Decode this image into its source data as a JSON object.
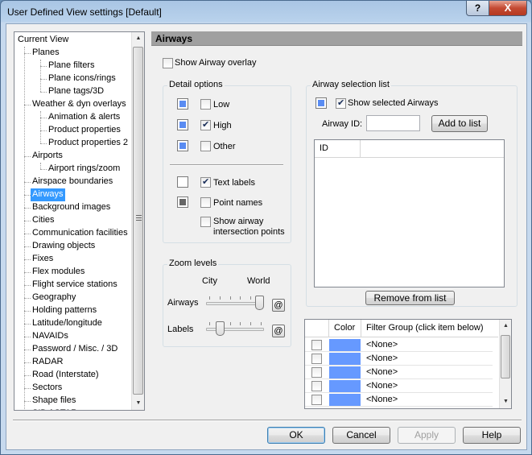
{
  "window": {
    "title": "User Defined View settings  [Default]",
    "help_label": "?",
    "close_label": "X"
  },
  "tree": {
    "items": [
      {
        "label": "Current View",
        "level": 0
      },
      {
        "label": "Planes",
        "level": 1
      },
      {
        "label": "Plane filters",
        "level": 2
      },
      {
        "label": "Plane icons/rings",
        "level": 2
      },
      {
        "label": "Plane tags/3D",
        "level": 2
      },
      {
        "label": "Weather & dyn overlays",
        "level": 1
      },
      {
        "label": "Animation & alerts",
        "level": 2
      },
      {
        "label": "Product properties",
        "level": 2
      },
      {
        "label": "Product properties 2",
        "level": 2
      },
      {
        "label": "Airports",
        "level": 1
      },
      {
        "label": "Airport rings/zoom",
        "level": 2
      },
      {
        "label": "Airspace boundaries",
        "level": 1
      },
      {
        "label": "Airways",
        "level": 1,
        "selected": true
      },
      {
        "label": "Background images",
        "level": 1
      },
      {
        "label": "Cities",
        "level": 1
      },
      {
        "label": "Communication facilities",
        "level": 1
      },
      {
        "label": "Drawing objects",
        "level": 1
      },
      {
        "label": "Fixes",
        "level": 1
      },
      {
        "label": "Flex modules",
        "level": 1
      },
      {
        "label": "Flight service stations",
        "level": 1
      },
      {
        "label": "Geography",
        "level": 1
      },
      {
        "label": "Holding patterns",
        "level": 1
      },
      {
        "label": "Latitude/longitude",
        "level": 1
      },
      {
        "label": "NAVAIDs",
        "level": 1
      },
      {
        "label": "Password / Misc. / 3D",
        "level": 1
      },
      {
        "label": "RADAR",
        "level": 1
      },
      {
        "label": "Road (Interstate)",
        "level": 1
      },
      {
        "label": "Sectors",
        "level": 1
      },
      {
        "label": "Shape files",
        "level": 1
      },
      {
        "label": "SID / STAR",
        "level": 1
      }
    ]
  },
  "panel": {
    "title": "Airways",
    "show_overlay_label": "Show Airway overlay",
    "show_overlay_checked": false
  },
  "detail": {
    "title": "Detail options",
    "low_label": "Low",
    "low_checked": false,
    "high_label": "High",
    "high_checked": true,
    "other_label": "Other",
    "other_checked": false,
    "text_labels_label": "Text labels",
    "text_labels_checked": true,
    "point_names_label": "Point names",
    "point_names_checked": false,
    "intersection_label_1": "Show airway",
    "intersection_label_2": "intersection points",
    "intersection_checked": false,
    "swatch_blue": "#5a8cf2",
    "swatch_white": "#ffffff",
    "swatch_gray": "#666666"
  },
  "zoom": {
    "title": "Zoom levels",
    "city_label": "City",
    "world_label": "World",
    "airways_label": "Airways",
    "labels_label": "Labels",
    "airways_value": 1.0,
    "labels_value": 0.2,
    "at_label": "@"
  },
  "selection": {
    "title": "Airway selection list",
    "show_selected_label": "Show selected Airways",
    "show_selected_checked": true,
    "airway_id_label": "Airway ID:",
    "airway_id_value": "",
    "add_label": "Add to list",
    "list_col_id": "ID",
    "remove_label": "Remove from list"
  },
  "filter_grid": {
    "col_color": "Color",
    "col_group": "Filter Group (click item below)",
    "row_color": "#6699ff",
    "rows": [
      "<None>",
      "<None>",
      "<None>",
      "<None>",
      "<None>"
    ]
  },
  "buttons": {
    "ok": "OK",
    "cancel": "Cancel",
    "apply": "Apply",
    "help": "Help"
  }
}
